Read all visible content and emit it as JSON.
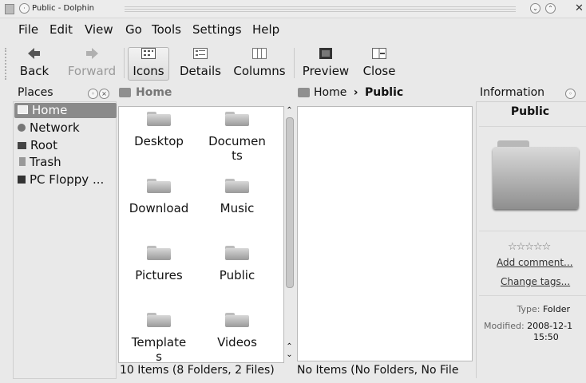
{
  "window": {
    "title": "Public - Dolphin"
  },
  "menu": [
    "File",
    "Edit",
    "View",
    "Go",
    "Tools",
    "Settings",
    "Help"
  ],
  "toolbar": {
    "back": "Back",
    "forward": "Forward",
    "icons": "Icons",
    "details": "Details",
    "columns": "Columns",
    "preview": "Preview",
    "close": "Close"
  },
  "places": {
    "title": "Places",
    "items": [
      "Home",
      "Network",
      "Root",
      "Trash",
      "PC Floppy ..."
    ]
  },
  "left_view": {
    "path": "Home",
    "items": [
      "Desktop",
      "Documen\nts",
      "Download",
      "Music",
      "Pictures",
      "Public",
      "Template\ns",
      "Videos"
    ],
    "status": "10 Items (8 Folders, 2 Files)"
  },
  "right_view": {
    "path_home": "Home",
    "path_sep": "›",
    "path_current": "Public",
    "status": "No Items (No Folders, No File"
  },
  "information": {
    "title": "Information",
    "name": "Public",
    "rating": "☆☆☆☆☆",
    "add_comment": "Add comment...",
    "change_tags": "Change tags...",
    "type_label": "Type:",
    "type_value": "Folder",
    "modified_label": "Modified:",
    "modified_value": "2008-12-1",
    "modified_time": "15:50"
  }
}
